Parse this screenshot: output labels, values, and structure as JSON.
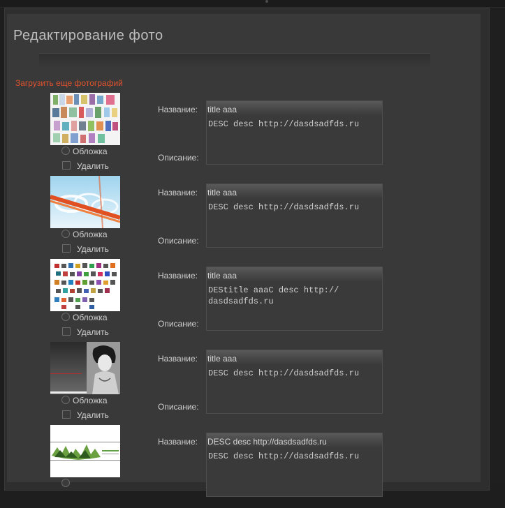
{
  "page": {
    "title": "Редактирование фото",
    "upload_more_label": "Загрузить еще фотографий"
  },
  "labels": {
    "cover": "Обложка",
    "delete": "Удалить",
    "name": "Название:",
    "description": "Описание:"
  },
  "photos": [
    {
      "name_value": "title aaa",
      "description_value": "DESC desc http://dasdsadfds.ru"
    },
    {
      "name_value": "title aaa",
      "description_value": "DESC desc http://dasdsadfds.ru"
    },
    {
      "name_value": "title aaa",
      "description_value": "DEStitle aaaC desc http://\ndasdsadfds.ru"
    },
    {
      "name_value": "title aaa",
      "description_value": "DESC desc http://dasdsadfds.ru"
    },
    {
      "name_value": "DESC desc http://dasdsadfds.ru",
      "description_value": "DESC desc http://dasdsadfds.ru"
    }
  ],
  "colors": {
    "link": "#e0522c",
    "panel": "#393939",
    "text": "#cfcfcf"
  }
}
